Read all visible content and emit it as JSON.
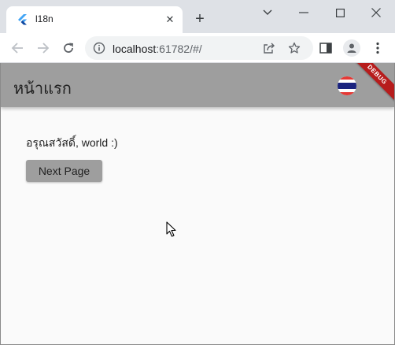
{
  "browser": {
    "tab": {
      "title": "l18n",
      "favicon": "flutter-icon",
      "close": "✕"
    },
    "new_tab": "+",
    "window_controls": {
      "dropdown": "chevron-down-icon",
      "minimize": "minimize-icon",
      "maximize": "maximize-icon",
      "close": "close-icon"
    },
    "toolbar": {
      "back": "arrow-left-icon",
      "forward": "arrow-right-icon",
      "reload": "reload-icon"
    },
    "omnibox": {
      "host": "localhost",
      "rest": ":61782/#/"
    }
  },
  "app": {
    "title": "หน้าแรก",
    "flag": "thailand-flag-icon",
    "debug_banner": "DEBUG",
    "greeting": "อรุณสวัสดิ์, world :)",
    "next_button": "Next Page",
    "colors": {
      "appbar": "#9e9e9e",
      "background": "#fafafa",
      "debug": "#b71c1c"
    }
  }
}
